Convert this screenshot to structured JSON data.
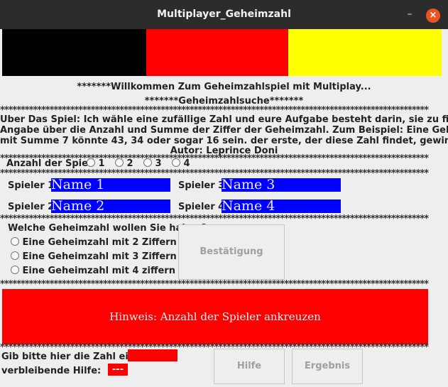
{
  "window": {
    "title": "Multiplayer_Geheimzahl",
    "minimize_glyph": "–",
    "close_glyph": "×"
  },
  "flag_colors": [
    "#000000",
    "#ff0000",
    "#ffff00"
  ],
  "header": {
    "welcome": "*******Willkommen Zum Geheimzahlspiel mit Multiplay...",
    "subtitle": "*******Geheimzahlsuche*******",
    "stars": "********************************************************************************************************"
  },
  "description": {
    "line1": "Über Das Spiel: Ich wähle eine zufällige Zahl und eure Aufgabe besteht darin, sie zu fi...",
    "line2": "Angabe über die Anzahl und Summe der Ziffer der Geheimzahl. Zum Beispiel: Eine Geh...",
    "line3": "mit Summe 7 könnte 43, 34 oder sogar 16 sein. der erste, der diese Zahl findet, gewim...",
    "author": "Autor: Leprince Doni"
  },
  "player_count": {
    "label": "Anzahl der Spie",
    "options": [
      "1",
      "2",
      "3",
      "4"
    ]
  },
  "players": [
    {
      "label": "Spieler 1",
      "name": "Name 1"
    },
    {
      "label": "Spieler 2",
      "name": "Name 2"
    },
    {
      "label": "Spieler 3",
      "name": "Name 3"
    },
    {
      "label": "Spieler 4",
      "name": "Name 4"
    }
  ],
  "digits": {
    "question": "Welche Geheimzahl wollen Sie haben?",
    "options": [
      "Eine Geheimzahl mit 2 Ziffern",
      "Eine Geheimzahl mit 3 Ziffern",
      "Eine Geheimzahl mit 4 ziffern"
    ],
    "confirm_label": "Bestätigung"
  },
  "hint_panel": {
    "text": "Hinweis: Anzahl der Spieler ankreuzen",
    "color": "#ff0000"
  },
  "bottom": {
    "input_label": "Gib bitte hier die Zahl ein:",
    "remaining_label": "verbleibende Hilfe:",
    "remaining_value": "---",
    "help_label": "Hilfe",
    "result_label": "Ergebnis"
  }
}
